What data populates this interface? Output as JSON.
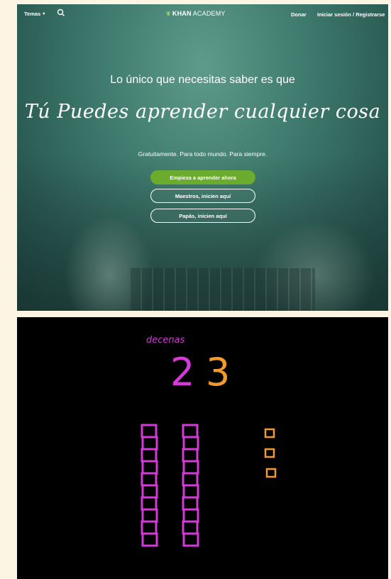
{
  "nav": {
    "topics_label": "Temas",
    "logo_bold": "KHAN",
    "logo_light": "ACADEMY",
    "donate_label": "Donar",
    "login_label": "Iniciar sesión / Registrarse"
  },
  "hero": {
    "subtitle": "Lo único que necesitas saber es que",
    "title": "Tú Puedes aprender cualquier cosa",
    "tagline": "Gratuitamente. Para todo mundo. Para siempre.",
    "primary_button": "Empieza a aprender ahora",
    "teachers_button": "Maestros, inicien aquí",
    "parents_button": "Papás, inicien aquí"
  },
  "board": {
    "label": "decenas",
    "tens_digit": "2",
    "ones_digit": "3",
    "ten_rods": 2,
    "cubes_per_rod": 10,
    "unit_cubes": 3
  },
  "colors": {
    "accent_green": "#6bab2e",
    "tens_color": "#d33ad8",
    "ones_color": "#f29a2e",
    "board_background": "#000000"
  }
}
